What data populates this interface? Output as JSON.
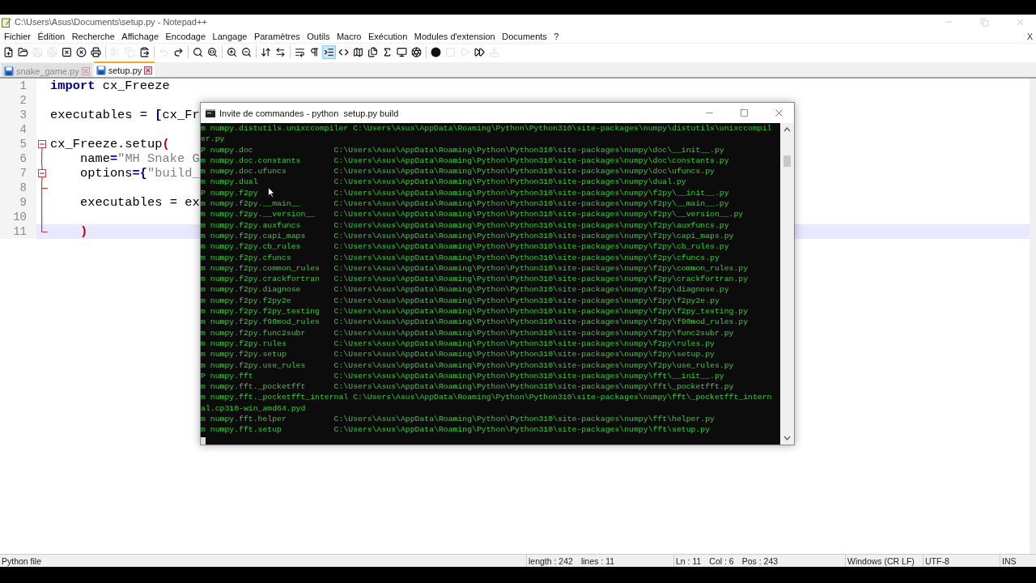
{
  "window": {
    "title": "C:\\Users\\Asus\\Documents\\setup.py - Notepad++"
  },
  "menu": [
    {
      "label": "Fichier"
    },
    {
      "label": "Édition"
    },
    {
      "label": "Recherche"
    },
    {
      "label": "Affichage"
    },
    {
      "label": "Encodage"
    },
    {
      "label": "Langage"
    },
    {
      "label": "Paramètres"
    },
    {
      "label": "Outils"
    },
    {
      "label": "Macro"
    },
    {
      "label": "Exécution"
    },
    {
      "label": "Modules d'extension"
    },
    {
      "label": "Documents"
    },
    {
      "label": "?"
    }
  ],
  "menu_close": "X",
  "toolbar": [
    {
      "kind": "new",
      "disabled": false,
      "selected": false
    },
    {
      "kind": "open",
      "disabled": false,
      "selected": false
    },
    {
      "kind": "save",
      "disabled": true,
      "selected": false
    },
    {
      "kind": "saveall",
      "disabled": true,
      "selected": false
    },
    {
      "kind": "close",
      "disabled": false,
      "selected": false
    },
    {
      "kind": "closeall",
      "disabled": false,
      "selected": false
    },
    {
      "kind": "print",
      "disabled": false,
      "selected": false
    },
    {
      "kind": "cut",
      "disabled": true,
      "selected": false
    },
    {
      "kind": "copy",
      "disabled": true,
      "selected": false
    },
    {
      "kind": "paste",
      "disabled": false,
      "selected": false
    },
    {
      "kind": "undo",
      "disabled": true,
      "selected": false
    },
    {
      "kind": "redo",
      "disabled": false,
      "selected": false
    },
    {
      "kind": "find",
      "disabled": false,
      "selected": false
    },
    {
      "kind": "replace",
      "disabled": false,
      "selected": false
    },
    {
      "kind": "zoomin",
      "disabled": false,
      "selected": false
    },
    {
      "kind": "zoomout",
      "disabled": false,
      "selected": false
    },
    {
      "kind": "syncv",
      "disabled": false,
      "selected": false
    },
    {
      "kind": "synch",
      "disabled": false,
      "selected": false
    },
    {
      "kind": "wrap",
      "disabled": false,
      "selected": false
    },
    {
      "kind": "symbols",
      "disabled": false,
      "selected": false
    },
    {
      "kind": "indent",
      "disabled": false,
      "selected": true
    },
    {
      "kind": "code",
      "disabled": false,
      "selected": false
    },
    {
      "kind": "map",
      "disabled": false,
      "selected": false
    },
    {
      "kind": "documents",
      "disabled": false,
      "selected": false
    },
    {
      "kind": "function",
      "disabled": false,
      "selected": false
    },
    {
      "kind": "monitor",
      "disabled": false,
      "selected": false
    },
    {
      "kind": "lens",
      "disabled": false,
      "selected": false
    },
    {
      "kind": "record",
      "disabled": false,
      "selected": false
    },
    {
      "kind": "stop",
      "disabled": true,
      "selected": false
    },
    {
      "kind": "play",
      "disabled": true,
      "selected": false
    },
    {
      "kind": "playmulti",
      "disabled": false,
      "selected": false
    },
    {
      "kind": "savemacro",
      "disabled": true,
      "selected": false
    }
  ],
  "tabs": [
    {
      "label": "snake_game.py",
      "selected": false
    },
    {
      "label": "setup.py",
      "selected": true
    }
  ],
  "editor": {
    "lines": [
      {
        "number": "1",
        "current": false,
        "fold_toggle": false,
        "fold_line": false,
        "fold_end": false,
        "tokens": [
          {
            "kind": "keyword",
            "text": "import"
          },
          {
            "kind": "plain",
            "text": " cx_Freeze"
          }
        ]
      },
      {
        "number": "2",
        "current": false,
        "fold_toggle": false,
        "fold_line": false,
        "fold_end": false
      },
      {
        "number": "3",
        "current": false,
        "fold_toggle": false,
        "fold_line": false,
        "fold_end": false,
        "tokens": [
          {
            "kind": "plain",
            "text": "executables = "
          },
          {
            "kind": "operator",
            "text": "["
          },
          {
            "kind": "plain",
            "text": "cx_Fr"
          }
        ]
      },
      {
        "number": "4",
        "current": false,
        "fold_toggle": false,
        "fold_line": false,
        "fold_end": false
      },
      {
        "number": "5",
        "current": false,
        "fold_toggle": true,
        "fold_line": false,
        "fold_end": false,
        "tokens": [
          {
            "kind": "plain",
            "text": "cx_Freeze.setup"
          },
          {
            "kind": "brace",
            "text": "("
          }
        ]
      },
      {
        "number": "6",
        "current": false,
        "fold_toggle": false,
        "fold_line": true,
        "fold_end": false,
        "tokens": [
          {
            "kind": "plain",
            "text": "    name"
          },
          {
            "kind": "operator",
            "text": "="
          },
          {
            "kind": "string",
            "text": "\"MH Snake G"
          }
        ]
      },
      {
        "number": "7",
        "current": false,
        "fold_toggle": true,
        "fold_line": true,
        "fold_end": false,
        "tokens": [
          {
            "kind": "plain",
            "text": "    options"
          },
          {
            "kind": "operator",
            "text": "={"
          },
          {
            "kind": "string",
            "text": "\"build_"
          }
        ]
      },
      {
        "number": "8",
        "current": false,
        "fold_toggle": false,
        "fold_line": true,
        "fold_end": true
      },
      {
        "number": "9",
        "current": false,
        "fold_toggle": false,
        "fold_line": true,
        "fold_end": false,
        "tokens": [
          {
            "kind": "plain",
            "text": "    executables = ex"
          }
        ]
      },
      {
        "number": "10",
        "current": false,
        "fold_toggle": false,
        "fold_line": true,
        "fold_end": false
      },
      {
        "number": "11",
        "current": true,
        "fold_toggle": false,
        "fold_line": false,
        "fold_end": true,
        "tokens": [
          {
            "kind": "brace",
            "text": "    )"
          }
        ]
      }
    ]
  },
  "console": {
    "title": "Invite de commandes - python  setup.py build",
    "lines": [
      {
        "kind": "entry",
        "flag": "m",
        "module": "numpy.distutils.unixccompiler",
        "path": "C:\\Users\\Asus\\AppData\\Roaming\\Python\\Python310\\site-packages\\numpy\\distutils\\unixccompil"
      },
      {
        "kind": "wrap",
        "text": "er.py"
      },
      {
        "kind": "entry",
        "flag": "P",
        "module": "numpy.doc",
        "path": "C:\\Users\\Asus\\AppData\\Roaming\\Python\\Python310\\site-packages\\numpy\\doc\\__init__.py"
      },
      {
        "kind": "entry",
        "flag": "m",
        "module": "numpy.doc.constants",
        "path": "C:\\Users\\Asus\\AppData\\Roaming\\Python\\Python310\\site-packages\\numpy\\doc\\constants.py"
      },
      {
        "kind": "entry",
        "flag": "m",
        "module": "numpy.doc.ufuncs",
        "path": "C:\\Users\\Asus\\AppData\\Roaming\\Python\\Python310\\site-packages\\numpy\\doc\\ufuncs.py"
      },
      {
        "kind": "entry",
        "flag": "m",
        "module": "numpy.dual",
        "path": "C:\\Users\\Asus\\AppData\\Roaming\\Python\\Python310\\site-packages\\numpy\\dual.py"
      },
      {
        "kind": "entry",
        "flag": "P",
        "module": "numpy.f2py",
        "path": "C:\\Users\\Asus\\AppData\\Roaming\\Python\\Python310\\site-packages\\numpy\\f2py\\__init__.py"
      },
      {
        "kind": "entry",
        "flag": "m",
        "module": "numpy.f2py.__main__",
        "path": "C:\\Users\\Asus\\AppData\\Roaming\\Python\\Python310\\site-packages\\numpy\\f2py\\__main__.py"
      },
      {
        "kind": "entry",
        "flag": "m",
        "module": "numpy.f2py.__version__",
        "path": "C:\\Users\\Asus\\AppData\\Roaming\\Python\\Python310\\site-packages\\numpy\\f2py\\__version__.py"
      },
      {
        "kind": "entry",
        "flag": "m",
        "module": "numpy.f2py.auxfuncs",
        "path": "C:\\Users\\Asus\\AppData\\Roaming\\Python\\Python310\\site-packages\\numpy\\f2py\\auxfuncs.py"
      },
      {
        "kind": "entry",
        "flag": "m",
        "module": "numpy.f2py.capi_maps",
        "path": "C:\\Users\\Asus\\AppData\\Roaming\\Python\\Python310\\site-packages\\numpy\\f2py\\capi_maps.py"
      },
      {
        "kind": "entry",
        "flag": "m",
        "module": "numpy.f2py.cb_rules",
        "path": "C:\\Users\\Asus\\AppData\\Roaming\\Python\\Python310\\site-packages\\numpy\\f2py\\cb_rules.py"
      },
      {
        "kind": "entry",
        "flag": "m",
        "module": "numpy.f2py.cfuncs",
        "path": "C:\\Users\\Asus\\AppData\\Roaming\\Python\\Python310\\site-packages\\numpy\\f2py\\cfuncs.py"
      },
      {
        "kind": "entry",
        "flag": "m",
        "module": "numpy.f2py.common_rules",
        "path": "C:\\Users\\Asus\\AppData\\Roaming\\Python\\Python310\\site-packages\\numpy\\f2py\\common_rules.py"
      },
      {
        "kind": "entry",
        "flag": "m",
        "module": "numpy.f2py.crackfortran",
        "path": "C:\\Users\\Asus\\AppData\\Roaming\\Python\\Python310\\site-packages\\numpy\\f2py\\crackfortran.py"
      },
      {
        "kind": "entry",
        "flag": "m",
        "module": "numpy.f2py.diagnose",
        "path": "C:\\Users\\Asus\\AppData\\Roaming\\Python\\Python310\\site-packages\\numpy\\f2py\\diagnose.py"
      },
      {
        "kind": "entry",
        "flag": "m",
        "module": "numpy.f2py.f2py2e",
        "path": "C:\\Users\\Asus\\AppData\\Roaming\\Python\\Python310\\site-packages\\numpy\\f2py\\f2py2e.py"
      },
      {
        "kind": "entry",
        "flag": "m",
        "module": "numpy.f2py.f2py_testing",
        "path": "C:\\Users\\Asus\\AppData\\Roaming\\Python\\Python310\\site-packages\\numpy\\f2py\\f2py_testing.py"
      },
      {
        "kind": "entry",
        "flag": "m",
        "module": "numpy.f2py.f90mod_rules",
        "path": "C:\\Users\\Asus\\AppData\\Roaming\\Python\\Python310\\site-packages\\numpy\\f2py\\f90mod_rules.py"
      },
      {
        "kind": "entry",
        "flag": "m",
        "module": "numpy.f2py.func2subr",
        "path": "C:\\Users\\Asus\\AppData\\Roaming\\Python\\Python310\\site-packages\\numpy\\f2py\\func2subr.py"
      },
      {
        "kind": "entry",
        "flag": "m",
        "module": "numpy.f2py.rules",
        "path": "C:\\Users\\Asus\\AppData\\Roaming\\Python\\Python310\\site-packages\\numpy\\f2py\\rules.py"
      },
      {
        "kind": "entry",
        "flag": "m",
        "module": "numpy.f2py.setup",
        "path": "C:\\Users\\Asus\\AppData\\Roaming\\Python\\Python310\\site-packages\\numpy\\f2py\\setup.py"
      },
      {
        "kind": "entry",
        "flag": "m",
        "module": "numpy.f2py.use_rules",
        "path": "C:\\Users\\Asus\\AppData\\Roaming\\Python\\Python310\\site-packages\\numpy\\f2py\\use_rules.py"
      },
      {
        "kind": "entry",
        "flag": "P",
        "module": "numpy.fft",
        "path": "C:\\Users\\Asus\\AppData\\Roaming\\Python\\Python310\\site-packages\\numpy\\fft\\__init__.py"
      },
      {
        "kind": "entry",
        "flag": "m",
        "module": "numpy.fft._pocketfft",
        "path": "C:\\Users\\Asus\\AppData\\Roaming\\Python\\Python310\\site-packages\\numpy\\fft\\_pocketfft.py"
      },
      {
        "kind": "entry",
        "flag": "m",
        "module": "numpy.fft._pocketfft_internal",
        "path": "C:\\Users\\Asus\\AppData\\Roaming\\Python\\Python310\\site-packages\\numpy\\fft\\_pocketfft_intern"
      },
      {
        "kind": "wrap",
        "text": "al.cp310-win_amd64.pyd"
      },
      {
        "kind": "entry",
        "flag": "m",
        "module": "numpy.fft.helper",
        "path": "C:\\Users\\Asus\\AppData\\Roaming\\Python\\Python310\\site-packages\\numpy\\fft\\helper.py"
      },
      {
        "kind": "entry",
        "flag": "m",
        "module": "numpy.fft.setup",
        "path": "C:\\Users\\Asus\\AppData\\Roaming\\Python\\Python310\\site-packages\\numpy\\fft\\setup.py"
      }
    ]
  },
  "status_bar": [
    [
      "Python file"
    ],
    [
      "length : 242",
      "lines : 11"
    ],
    [
      "Ln : 11",
      "Col : 6",
      "Pos : 243"
    ],
    [
      "Windows (CR LF)"
    ],
    [
      "UTF-8"
    ],
    [
      "INS"
    ]
  ]
}
